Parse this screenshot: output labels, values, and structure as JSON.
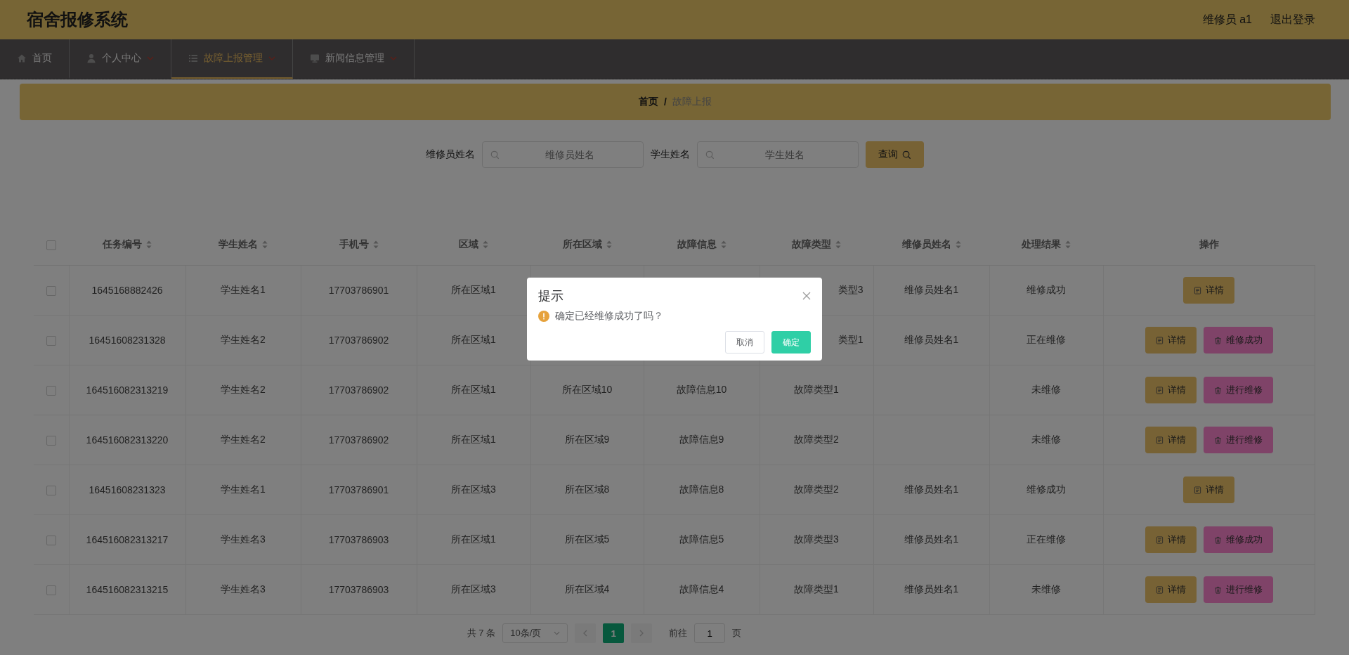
{
  "header": {
    "title": "宿舍报修系统",
    "user": "维修员 a1",
    "logout": "退出登录"
  },
  "nav": [
    {
      "label": "首页",
      "dropdown": false,
      "selected": false
    },
    {
      "label": "个人中心",
      "dropdown": true,
      "selected": false
    },
    {
      "label": "故障上报管理",
      "dropdown": true,
      "selected": true
    },
    {
      "label": "新闻信息管理",
      "dropdown": true,
      "selected": false
    }
  ],
  "breadcrumb": [
    {
      "label": "首页",
      "current": false
    },
    {
      "label": "故障上报",
      "current": true
    }
  ],
  "breadcrumb_separator": "/",
  "search": {
    "fields": [
      {
        "label": "维修员姓名",
        "placeholder": "维修员姓名"
      },
      {
        "label": "学生姓名",
        "placeholder": "学生姓名"
      }
    ],
    "button": "查询"
  },
  "table": {
    "header_checkbox": {
      "checked": false
    },
    "columns": [
      {
        "label": "任务编号",
        "sortable": true
      },
      {
        "label": "学生姓名",
        "sortable": true
      },
      {
        "label": "手机号",
        "sortable": true
      },
      {
        "label": "区域",
        "sortable": true
      },
      {
        "label": "所在区域",
        "sortable": true
      },
      {
        "label": "故障信息",
        "sortable": true
      },
      {
        "label": "故障类型",
        "sortable": true
      },
      {
        "label": "维修员姓名",
        "sortable": true
      },
      {
        "label": "处理结果",
        "sortable": true
      },
      {
        "label": "操作",
        "sortable": false
      }
    ],
    "rows": [
      {
        "checked": false,
        "cells": [
          "1645168882426",
          "学生姓名1",
          "17703786901",
          "所在区域1",
          "",
          "",
          {
            "text": "类型3",
            "clipped": true
          },
          "维修员姓名1",
          "维修成功"
        ],
        "actions": [
          {
            "label": "详情",
            "kind": "detail"
          }
        ]
      },
      {
        "checked": false,
        "cells": [
          "16451608231328",
          "学生姓名2",
          "17703786902",
          "所在区域1",
          "",
          "",
          {
            "text": "类型1",
            "clipped": true
          },
          "维修员姓名1",
          "正在维修"
        ],
        "actions": [
          {
            "label": "详情",
            "kind": "detail"
          },
          {
            "label": "维修成功",
            "kind": "delete"
          }
        ]
      },
      {
        "checked": false,
        "cells": [
          "164516082313219",
          "学生姓名2",
          "17703786902",
          "所在区域1",
          "所在区域10",
          "故障信息10",
          "故障类型1",
          "",
          "未维修"
        ],
        "actions": [
          {
            "label": "详情",
            "kind": "detail"
          },
          {
            "label": "进行维修",
            "kind": "delete"
          }
        ]
      },
      {
        "checked": false,
        "cells": [
          "164516082313220",
          "学生姓名2",
          "17703786902",
          "所在区域1",
          "所在区域9",
          "故障信息9",
          "故障类型2",
          "",
          "未维修"
        ],
        "actions": [
          {
            "label": "详情",
            "kind": "detail"
          },
          {
            "label": "进行维修",
            "kind": "delete"
          }
        ]
      },
      {
        "checked": false,
        "cells": [
          "16451608231323",
          "学生姓名1",
          "17703786901",
          "所在区域3",
          "所在区域8",
          "故障信息8",
          "故障类型2",
          "维修员姓名1",
          "维修成功"
        ],
        "actions": [
          {
            "label": "详情",
            "kind": "detail"
          }
        ]
      },
      {
        "checked": false,
        "cells": [
          "164516082313217",
          "学生姓名3",
          "17703786903",
          "所在区域1",
          "所在区域5",
          "故障信息5",
          "故障类型3",
          "维修员姓名1",
          "正在维修"
        ],
        "actions": [
          {
            "label": "详情",
            "kind": "detail"
          },
          {
            "label": "维修成功",
            "kind": "delete"
          }
        ]
      },
      {
        "checked": false,
        "cells": [
          "164516082313215",
          "学生姓名3",
          "17703786903",
          "所在区域3",
          "所在区域4",
          "故障信息4",
          "故障类型1",
          "维修员姓名1",
          "未维修"
        ],
        "actions": [
          {
            "label": "详情",
            "kind": "detail"
          },
          {
            "label": "进行维修",
            "kind": "delete"
          }
        ]
      }
    ]
  },
  "pagination": {
    "total": "共 7 条",
    "page_size": "10条/页",
    "pages": [
      {
        "label": "1",
        "selected": true
      }
    ],
    "goto_label": "前往",
    "goto_value": "1",
    "goto_suffix": "页"
  },
  "dialog": {
    "title": "提示",
    "message": "确定已经维修成功了吗？",
    "buttons": [
      {
        "label": "取消",
        "kind": "default"
      },
      {
        "label": "确定",
        "kind": "primary"
      }
    ]
  }
}
